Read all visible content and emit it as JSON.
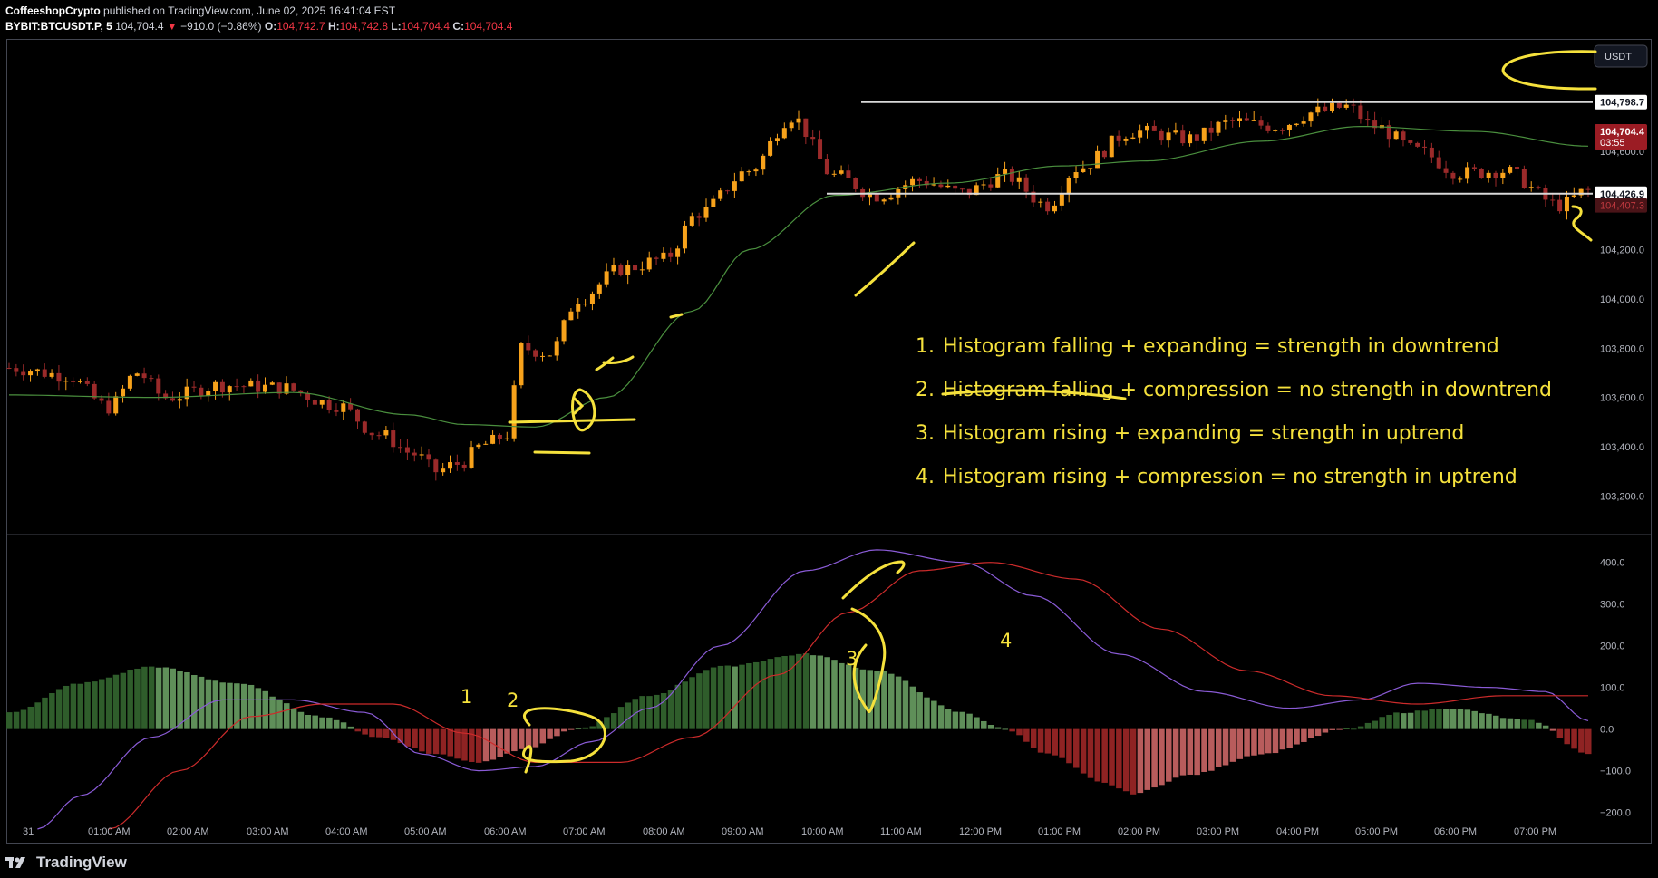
{
  "header": {
    "author": "CoffeeshopCrypto",
    "published": "published on TradingView.com, June 02, 2025 16:41:04 EST"
  },
  "ohlc": {
    "symbol": "BYBIT:BTCUSDT.P, 5",
    "last": "104,704.4",
    "change": "−910.0 (−0.86%)",
    "o_label": "O:",
    "o": "104,742.7",
    "h_label": "H:",
    "h": "104,742.8",
    "l_label": "L:",
    "l": "104,704.4",
    "c_label": "C:",
    "c": "104,704.4"
  },
  "currency_badge": "USDT",
  "price_labels": {
    "resistance": "104,798.7",
    "last": "104,704.4",
    "countdown": "03:55",
    "support": "104,426.9",
    "other": "104,407.3"
  },
  "notes": [
    {
      "num": "1.",
      "text": "Histogram falling + expanding = strength in downtrend"
    },
    {
      "num": "2.",
      "text": "Histogram falling + compression = no strength in downtrend"
    },
    {
      "num": "3.",
      "text": "Histogram rising + expanding = strength in uptrend"
    },
    {
      "num": "4.",
      "text": "Histogram rising + compression = no strength in uptrend"
    }
  ],
  "markers": [
    "1",
    "2",
    "3",
    "4"
  ],
  "footer": {
    "brand": "TradingView"
  },
  "colors": {
    "up_candle": "#f7a21b",
    "down_candle": "#9b2a2a",
    "ma": "#4a8f3e",
    "level": "#d9d9d9",
    "annotation": "#f5e13c",
    "macd": "#8a5bd6",
    "signal": "#cc2b2b",
    "hist_pos": "#3f6e39",
    "hist_neg": "#8f2b2b"
  },
  "chart_data": [
    {
      "type": "candlestick",
      "title": "BYBIT:BTCUSDT.P, 5",
      "y_axis_ticks": [
        "104,600.0",
        "104,400.0",
        "104,200.0",
        "104,000.0",
        "103,800.0",
        "103,600.0",
        "103,400.0",
        "103,200.0"
      ],
      "y_axis_values": [
        104600,
        104400,
        104200,
        104000,
        103800,
        103600,
        103400,
        103200
      ],
      "ylim": [
        103080,
        105000
      ],
      "x_axis_ticks": [
        "31",
        "01:00 AM",
        "02:00 AM",
        "03:00 AM",
        "04:00 AM",
        "05:00 AM",
        "06:00 AM",
        "07:00 AM",
        "08:00 AM",
        "09:00 AM",
        "10:00 AM",
        "11:00 AM",
        "12:00 PM",
        "01:00 PM",
        "02:00 PM",
        "03:00 PM",
        "04:00 PM",
        "05:00 PM",
        "06:00 PM",
        "07:00 PM"
      ],
      "horizontal_levels": [
        104798.7,
        104426.9
      ],
      "close_anchors": [
        [
          0,
          103720
        ],
        [
          8,
          103690
        ],
        [
          14,
          103560
        ],
        [
          18,
          103700
        ],
        [
          22,
          103600
        ],
        [
          30,
          103650
        ],
        [
          38,
          103640
        ],
        [
          46,
          103570
        ],
        [
          52,
          103450
        ],
        [
          57,
          103370
        ],
        [
          60,
          103300
        ],
        [
          63,
          103330
        ],
        [
          67,
          103410
        ],
        [
          70,
          103450
        ],
        [
          72,
          103800
        ],
        [
          76,
          103780
        ],
        [
          80,
          104000
        ],
        [
          86,
          104120
        ],
        [
          92,
          104160
        ],
        [
          97,
          104350
        ],
        [
          104,
          104520
        ],
        [
          110,
          104740
        ],
        [
          116,
          104500
        ],
        [
          122,
          104420
        ],
        [
          128,
          104480
        ],
        [
          134,
          104430
        ],
        [
          140,
          104500
        ],
        [
          146,
          104380
        ],
        [
          150,
          104530
        ],
        [
          158,
          104680
        ],
        [
          166,
          104650
        ],
        [
          172,
          104720
        ],
        [
          178,
          104700
        ],
        [
          184,
          104760
        ],
        [
          188,
          104780
        ],
        [
          192,
          104700
        ],
        [
          198,
          104600
        ],
        [
          204,
          104510
        ],
        [
          210,
          104520
        ],
        [
          218,
          104380
        ],
        [
          222,
          104440
        ]
      ],
      "ma_anchors": [
        [
          0,
          103610
        ],
        [
          20,
          103600
        ],
        [
          40,
          103620
        ],
        [
          56,
          103530
        ],
        [
          64,
          103490
        ],
        [
          74,
          103480
        ],
        [
          84,
          103600
        ],
        [
          96,
          103950
        ],
        [
          104,
          104200
        ],
        [
          116,
          104420
        ],
        [
          132,
          104470
        ],
        [
          148,
          104540
        ],
        [
          160,
          104560
        ],
        [
          176,
          104640
        ],
        [
          190,
          104700
        ],
        [
          206,
          104680
        ],
        [
          222,
          104620
        ]
      ]
    },
    {
      "type": "macd",
      "y_axis_ticks": [
        "400.0",
        "300.0",
        "200.0",
        "100.0",
        "0.0",
        "−100.0",
        "−200.0"
      ],
      "y_axis_values": [
        400,
        300,
        200,
        100,
        0,
        -100,
        -200
      ],
      "ylim": [
        -240,
        445
      ],
      "histogram_anchors": [
        [
          0,
          40
        ],
        [
          10,
          110
        ],
        [
          20,
          150
        ],
        [
          32,
          110
        ],
        [
          44,
          30
        ],
        [
          52,
          -20
        ],
        [
          60,
          -60
        ],
        [
          66,
          -80
        ],
        [
          72,
          -50
        ],
        [
          80,
          0
        ],
        [
          90,
          80
        ],
        [
          100,
          150
        ],
        [
          112,
          180
        ],
        [
          122,
          140
        ],
        [
          134,
          40
        ],
        [
          140,
          0
        ],
        [
          146,
          -60
        ],
        [
          154,
          -130
        ],
        [
          158,
          -155
        ],
        [
          166,
          -110
        ],
        [
          176,
          -60
        ],
        [
          188,
          0
        ],
        [
          196,
          40
        ],
        [
          202,
          50
        ],
        [
          214,
          20
        ],
        [
          222,
          -60
        ]
      ],
      "macd_anchors": [
        [
          4,
          -240
        ],
        [
          10,
          -160
        ],
        [
          20,
          -20
        ],
        [
          30,
          70
        ],
        [
          40,
          70
        ],
        [
          50,
          40
        ],
        [
          58,
          -60
        ],
        [
          66,
          -100
        ],
        [
          74,
          -90
        ],
        [
          82,
          -30
        ],
        [
          90,
          50
        ],
        [
          100,
          200
        ],
        [
          112,
          380
        ],
        [
          122,
          430
        ],
        [
          134,
          400
        ],
        [
          144,
          320
        ],
        [
          156,
          180
        ],
        [
          168,
          90
        ],
        [
          180,
          50
        ],
        [
          190,
          70
        ],
        [
          198,
          110
        ],
        [
          208,
          100
        ],
        [
          216,
          90
        ],
        [
          222,
          20
        ]
      ],
      "signal_anchors": [
        [
          14,
          -240
        ],
        [
          24,
          -100
        ],
        [
          34,
          30
        ],
        [
          44,
          60
        ],
        [
          54,
          60
        ],
        [
          64,
          -10
        ],
        [
          74,
          -80
        ],
        [
          86,
          -80
        ],
        [
          96,
          -20
        ],
        [
          108,
          130
        ],
        [
          118,
          280
        ],
        [
          128,
          380
        ],
        [
          138,
          400
        ],
        [
          150,
          360
        ],
        [
          162,
          240
        ],
        [
          174,
          140
        ],
        [
          186,
          80
        ],
        [
          198,
          60
        ],
        [
          210,
          80
        ],
        [
          222,
          80
        ]
      ]
    }
  ]
}
